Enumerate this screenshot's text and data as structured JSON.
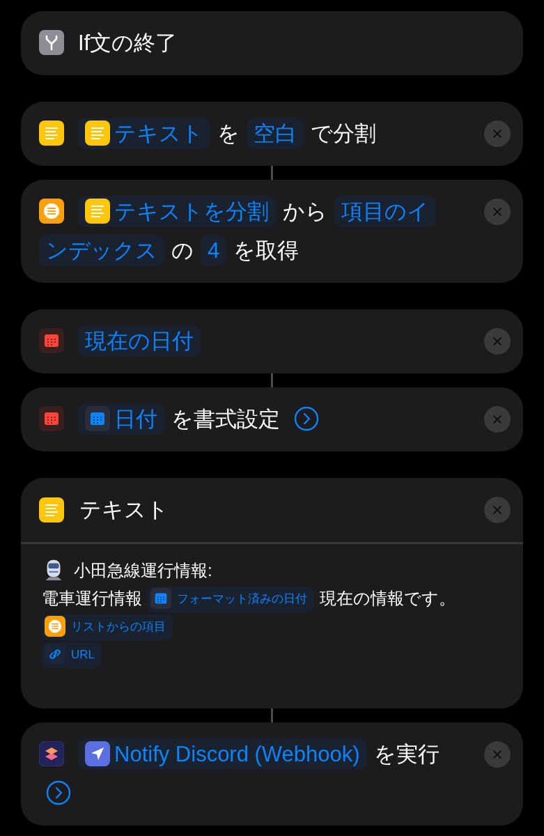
{
  "actions": [
    {
      "kind": "action",
      "icon": {
        "kind": "if"
      },
      "connected": false,
      "removable": false,
      "parts": [
        {
          "kind": "text",
          "text": "If文の終了"
        }
      ]
    },
    {
      "kind": "action",
      "icon": {
        "kind": "text"
      },
      "connected": false,
      "removable": true,
      "parts": [
        {
          "kind": "token",
          "icon": {
            "kind": "text"
          },
          "text": "テキスト"
        },
        {
          "kind": "text",
          "text": "を"
        },
        {
          "kind": "token",
          "text": "空白"
        },
        {
          "kind": "text",
          "text": "で分割"
        }
      ]
    },
    {
      "kind": "action",
      "icon": {
        "kind": "list"
      },
      "connected": true,
      "removable": true,
      "parts": [
        {
          "kind": "token",
          "icon": {
            "kind": "text"
          },
          "text": "テキストを分割"
        },
        {
          "kind": "text",
          "text": "から"
        },
        {
          "kind": "token",
          "text": "項目のイ"
        },
        {
          "kind": "token",
          "text": "ンデックス"
        },
        {
          "kind": "text",
          "text": "の"
        },
        {
          "kind": "token",
          "text": "4"
        },
        {
          "kind": "text",
          "text": "を取得"
        }
      ]
    },
    {
      "kind": "action",
      "icon": {
        "kind": "calendar"
      },
      "connected": false,
      "removable": true,
      "parts": [
        {
          "kind": "token",
          "text": "現在の日付"
        }
      ]
    },
    {
      "kind": "action",
      "icon": {
        "kind": "calendar"
      },
      "connected": true,
      "removable": true,
      "parts": [
        {
          "kind": "token",
          "icon": {
            "kind": "calendar"
          },
          "text": "日付"
        },
        {
          "kind": "text",
          "text": "を書式設定"
        },
        {
          "kind": "chevron"
        }
      ]
    },
    {
      "kind": "text_block",
      "icon": {
        "kind": "text"
      },
      "connected": false,
      "removable": true,
      "title": "テキスト",
      "lines": [
        [
          {
            "kind": "icon",
            "icon": {
              "kind": "train"
            }
          },
          {
            "kind": "text",
            "text": "小田急線運行情報:"
          }
        ],
        [
          {
            "kind": "text",
            "text": "電車運行情報"
          },
          {
            "kind": "token",
            "icon": {
              "kind": "calendar"
            },
            "text": "フォーマット済みの日付"
          },
          {
            "kind": "text",
            "text": "現在の情報です。"
          }
        ],
        [
          {
            "kind": "token",
            "icon": {
              "kind": "list"
            },
            "text": "リストからの項目"
          }
        ],
        [
          {
            "kind": "token",
            "icon": {
              "kind": "link"
            },
            "text": "URL"
          }
        ]
      ]
    },
    {
      "kind": "action",
      "icon": {
        "kind": "shortcuts"
      },
      "connected": true,
      "removable": true,
      "parts": [
        {
          "kind": "token",
          "icon": {
            "kind": "send"
          },
          "text": "Notify Discord (Webhook)"
        },
        {
          "kind": "text",
          "text": "を実行"
        },
        {
          "kind": "chevron"
        }
      ]
    }
  ]
}
